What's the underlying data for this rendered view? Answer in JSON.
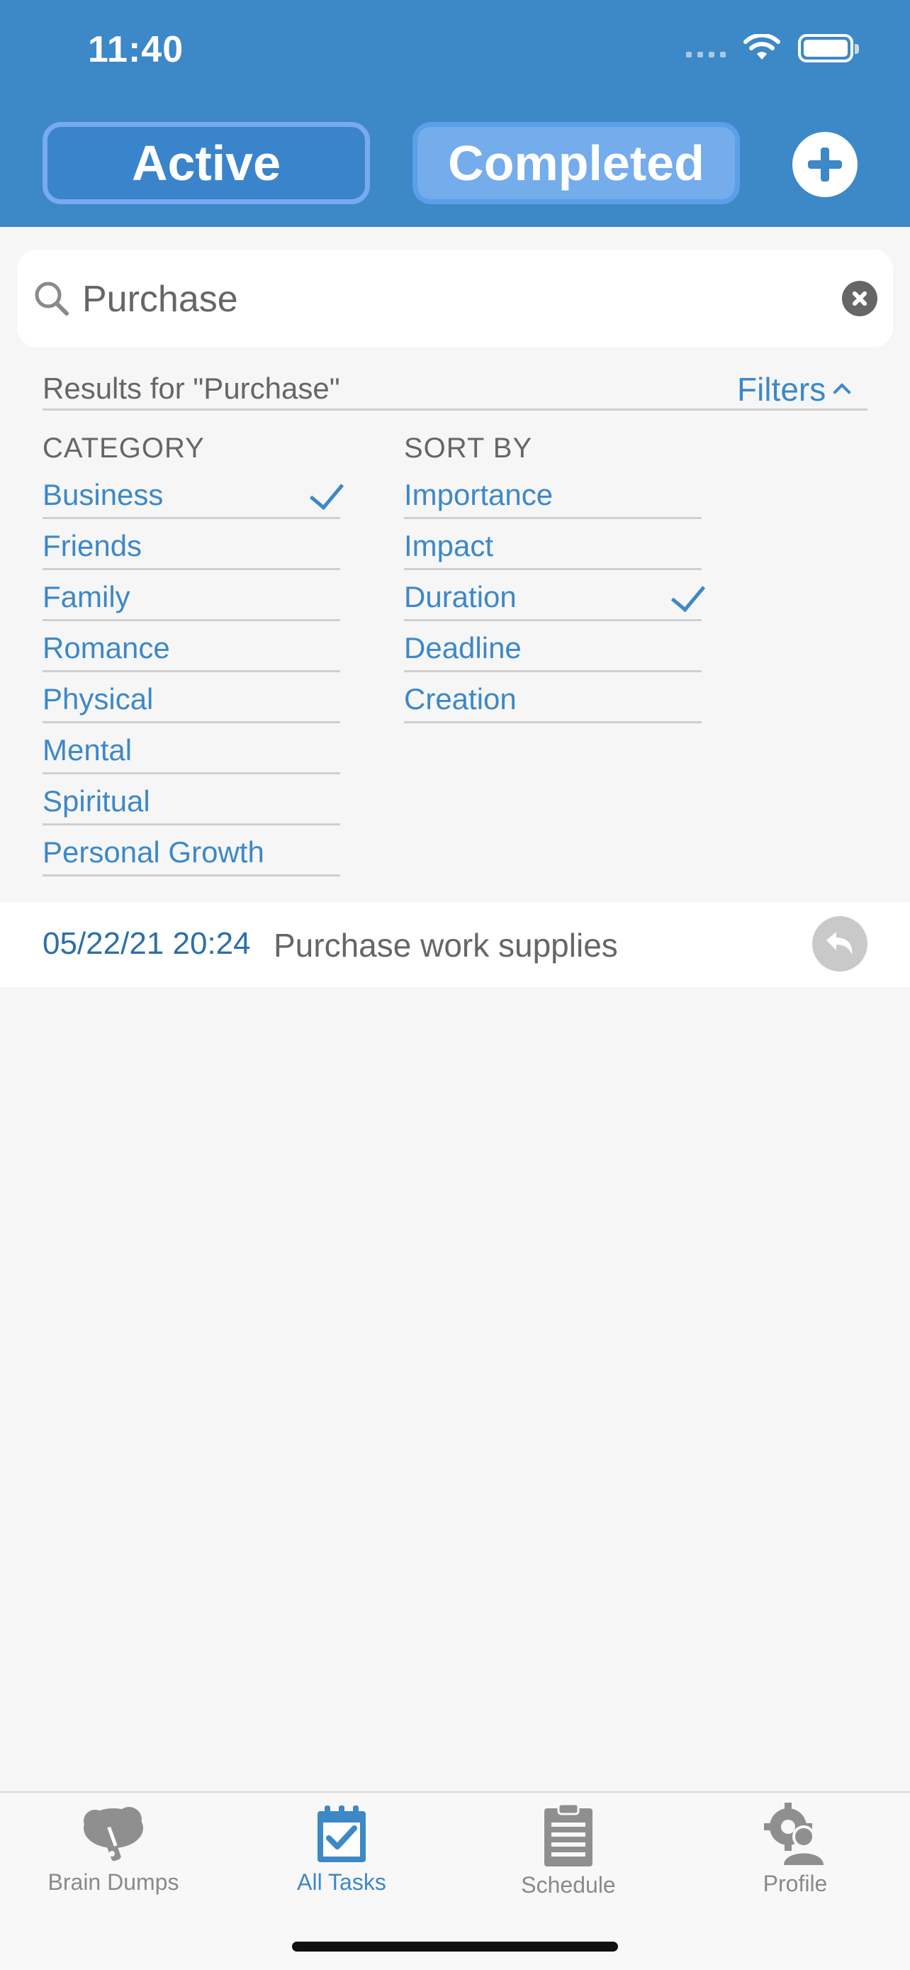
{
  "status_bar": {
    "time": "11:40"
  },
  "header": {
    "segments": [
      {
        "label": "Active",
        "selected": false
      },
      {
        "label": "Completed",
        "selected": true
      }
    ],
    "add_icon": "plus-circle-icon"
  },
  "search": {
    "value": "Purchase",
    "placeholder": "Search"
  },
  "results": {
    "label": "Results for \"Purchase\"",
    "filters_label": "Filters"
  },
  "filters": {
    "category_heading": "CATEGORY",
    "sort_heading": "SORT BY",
    "categories": [
      {
        "label": "Business",
        "checked": true
      },
      {
        "label": "Friends",
        "checked": false
      },
      {
        "label": "Family",
        "checked": false
      },
      {
        "label": "Romance",
        "checked": false
      },
      {
        "label": "Physical",
        "checked": false
      },
      {
        "label": "Mental",
        "checked": false
      },
      {
        "label": "Spiritual",
        "checked": false
      },
      {
        "label": "Personal Growth",
        "checked": false
      }
    ],
    "sort_options": [
      {
        "label": "Importance",
        "checked": false
      },
      {
        "label": "Impact",
        "checked": false
      },
      {
        "label": "Duration",
        "checked": true
      },
      {
        "label": "Deadline",
        "checked": false
      },
      {
        "label": "Creation",
        "checked": false
      }
    ]
  },
  "tasks": [
    {
      "date": "05/22/21 20:24",
      "title": "Purchase work supplies"
    }
  ],
  "tabbar": {
    "tabs": [
      {
        "label": "Brain Dumps",
        "icon": "brain-icon",
        "active": false
      },
      {
        "label": "All Tasks",
        "icon": "calendar-check-icon",
        "active": true
      },
      {
        "label": "Schedule",
        "icon": "clipboard-icon",
        "active": false
      },
      {
        "label": "Profile",
        "icon": "profile-gear-icon",
        "active": false
      }
    ]
  },
  "colors": {
    "primary": "#3d88c7",
    "header_bg": "#3d88c7",
    "page_bg": "#f6f6f6",
    "muted": "#8a8a8a"
  }
}
